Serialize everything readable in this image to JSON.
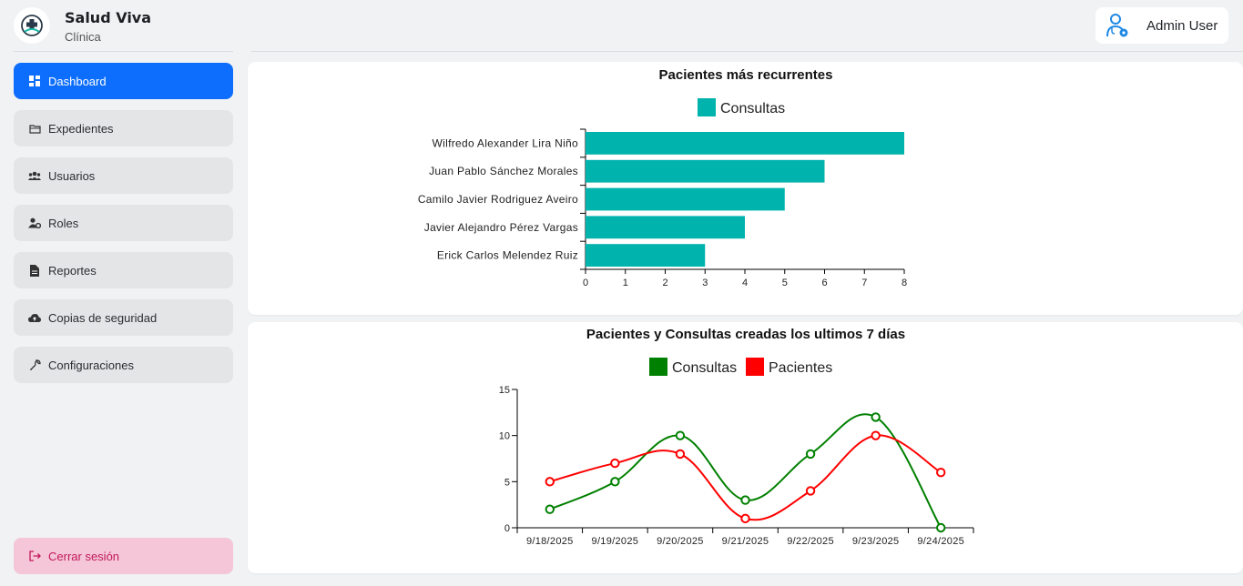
{
  "brand": {
    "name": "Salud Viva",
    "subtitle": "Clínica"
  },
  "nav": {
    "items": [
      {
        "label": "Dashboard",
        "icon": "dashboard-icon",
        "active": true
      },
      {
        "label": "Expedientes",
        "icon": "folder-icon"
      },
      {
        "label": "Usuarios",
        "icon": "users-icon"
      },
      {
        "label": "Roles",
        "icon": "user-gear-icon"
      },
      {
        "label": "Reportes",
        "icon": "file-icon"
      },
      {
        "label": "Copias de seguridad",
        "icon": "cloud-upload-icon"
      },
      {
        "label": "Configuraciones",
        "icon": "wrench-icon"
      }
    ],
    "logout": "Cerrar sesión"
  },
  "user": {
    "name": "Admin User",
    "icon": "doctor-user-icon"
  },
  "colors": {
    "accent": "#0d6efd",
    "teal": "#00b3ad",
    "green": "#008000",
    "red": "#ff0000",
    "logout_text": "#c2185b"
  },
  "chart_data": [
    {
      "type": "bar",
      "orientation": "horizontal",
      "title": "Pacientes más recurrentes",
      "categories": [
        "Wilfredo Alexander Lira Niño",
        "Juan Pablo Sánchez Morales",
        "Camilo Javier Rodriguez Aveiro",
        "Javier Alejandro Pérez Vargas",
        "Erick Carlos Melendez Ruiz"
      ],
      "series": [
        {
          "name": "Consultas",
          "values": [
            8,
            6,
            5,
            4,
            3
          ],
          "color": "#00b3ad"
        }
      ],
      "xlim": [
        0,
        8
      ],
      "xticks": [
        "0",
        "1",
        "2",
        "3",
        "4",
        "5",
        "6",
        "7",
        "8"
      ],
      "legend": "top"
    },
    {
      "type": "line",
      "title": "Pacientes y Consultas creadas los ultimos 7 días",
      "categories": [
        "9/18/2025",
        "9/19/2025",
        "9/20/2025",
        "9/21/2025",
        "9/22/2025",
        "9/23/2025",
        "9/24/2025"
      ],
      "series": [
        {
          "name": "Consultas",
          "values": [
            2,
            5,
            10,
            3,
            8,
            12,
            0
          ],
          "color": "#008000"
        },
        {
          "name": "Pacientes",
          "values": [
            5,
            7,
            8,
            1,
            4,
            10,
            6
          ],
          "color": "#ff0000"
        }
      ],
      "ylim": [
        0,
        15
      ],
      "yticks": [
        "0",
        "5",
        "10",
        "15"
      ],
      "legend": "top"
    }
  ]
}
